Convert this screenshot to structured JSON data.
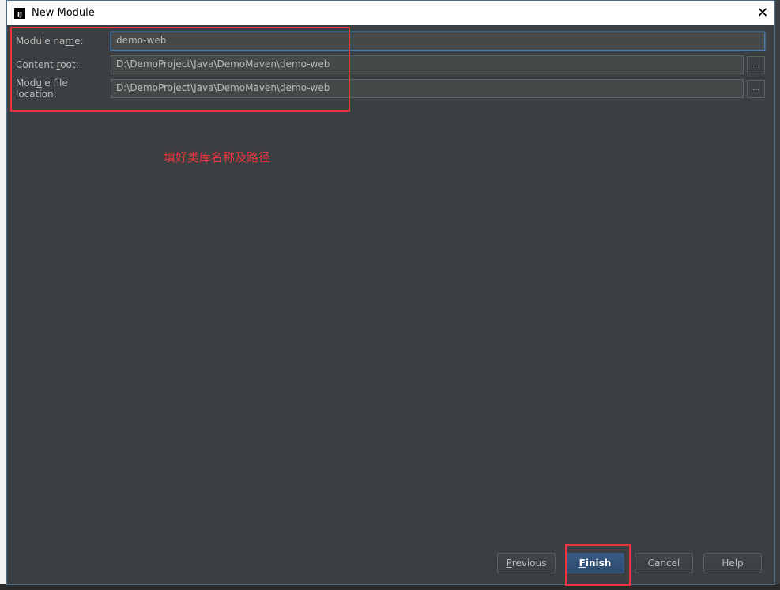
{
  "dialog": {
    "title": "New Module",
    "app_icon_text": "IJ",
    "close_glyph": "✕"
  },
  "form": {
    "module_name": {
      "label_pre": "Module na",
      "label_mn": "m",
      "label_post": "e:",
      "value": "demo-web"
    },
    "content_root": {
      "label_pre": "Content ",
      "label_mn": "r",
      "label_post": "oot:",
      "value": "D:\\DemoProject\\Java\\DemoMaven\\demo-web"
    },
    "module_file_location": {
      "label_pre": "Mod",
      "label_mn": "u",
      "label_post": "le file location:",
      "value": "D:\\DemoProject\\Java\\DemoMaven\\demo-web"
    },
    "browse_label": "..."
  },
  "annotation": {
    "text": "填好类库名称及路径",
    "color": "#e8363c"
  },
  "buttons": {
    "previous": {
      "mn": "P",
      "rest": "revious"
    },
    "finish": {
      "mn": "F",
      "rest": "inish"
    },
    "cancel": "Cancel",
    "help": "Help"
  }
}
